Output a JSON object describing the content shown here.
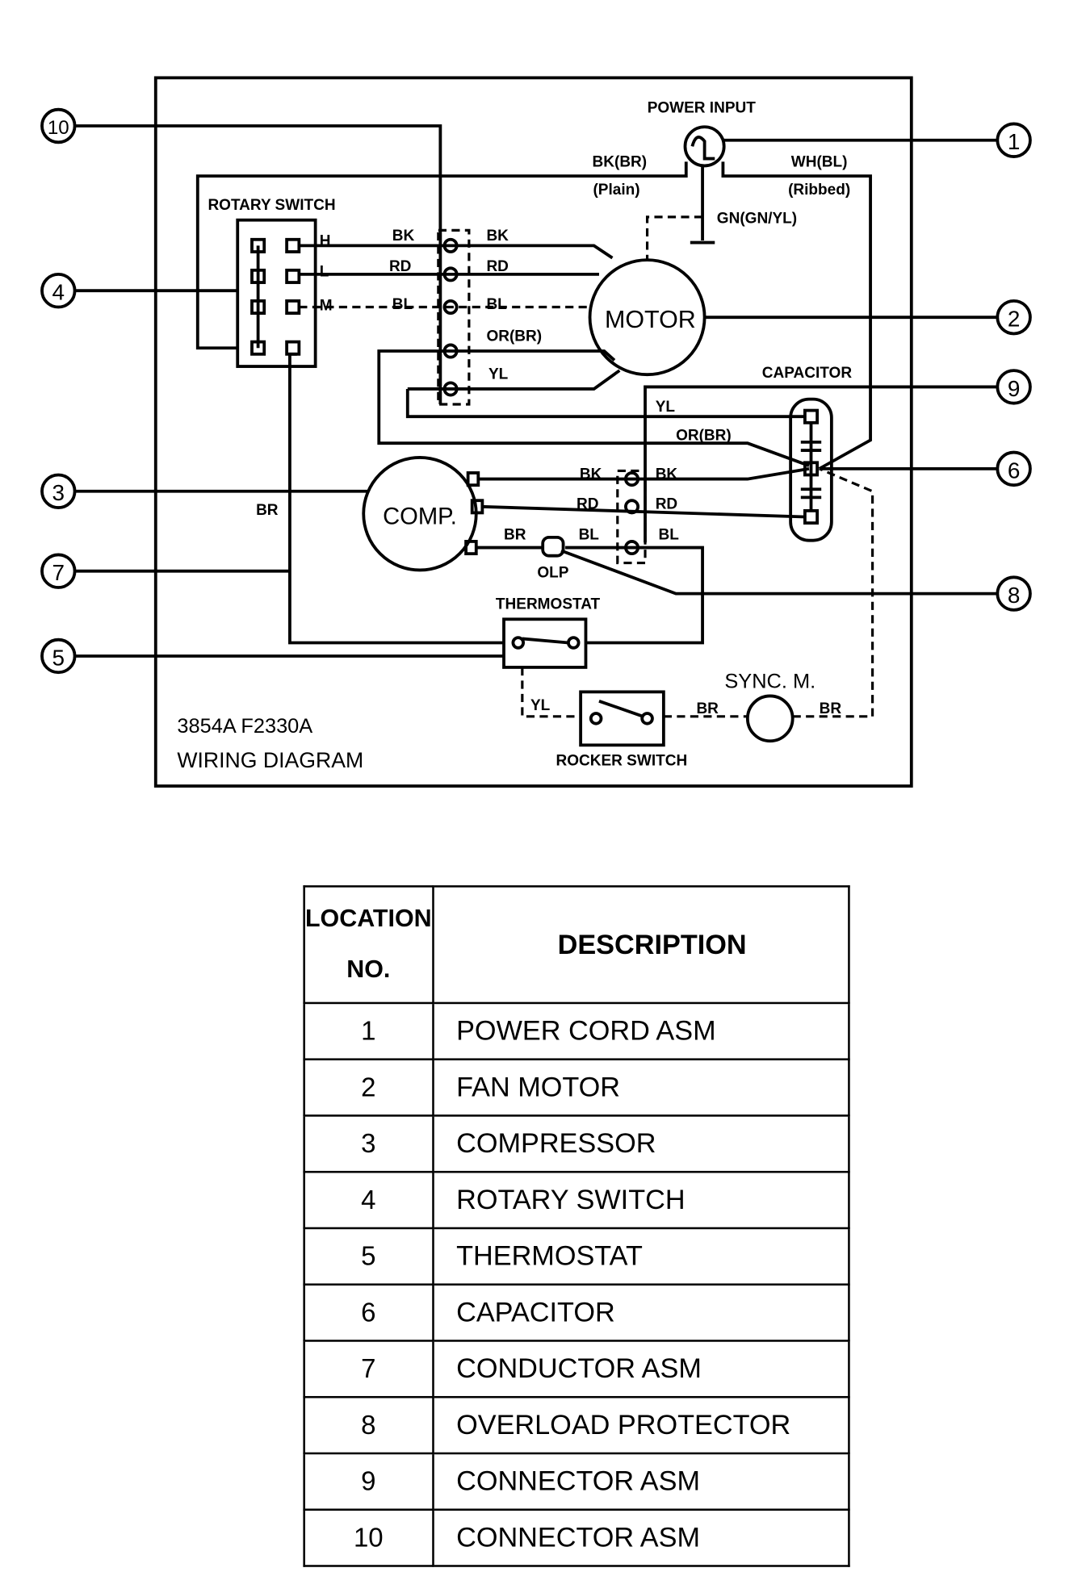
{
  "diagram": {
    "power_input": "POWER INPUT",
    "bk_br": "BK(BR)",
    "plain": "(Plain)",
    "wh_bl": "WH(BL)",
    "ribbed": "(Ribbed)",
    "gn": "GN(GN/YL)",
    "rotary_switch": "ROTARY SWITCH",
    "h": "H",
    "l": "L",
    "m": "M",
    "bk": "BK",
    "rd": "RD",
    "bl": "BL",
    "or_br": "OR(BR)",
    "yl": "YL",
    "br": "BR",
    "motor": "MOTOR",
    "capacitor": "CAPACITOR",
    "comp": "COMP.",
    "olp": "OLP",
    "thermostat": "THERMOSTAT",
    "sync_m": "SYNC. M.",
    "rocker_switch": "ROCKER SWITCH",
    "part_no": "3854A F2330A",
    "title": "WIRING DIAGRAM",
    "callouts": [
      "1",
      "2",
      "3",
      "4",
      "5",
      "6",
      "7",
      "8",
      "9",
      "10"
    ]
  },
  "table": {
    "header_location": "LOCATION",
    "header_no": "NO.",
    "header_description": "DESCRIPTION",
    "rows": [
      {
        "no": "1",
        "desc": "POWER CORD ASM"
      },
      {
        "no": "2",
        "desc": "FAN MOTOR"
      },
      {
        "no": "3",
        "desc": "COMPRESSOR"
      },
      {
        "no": "4",
        "desc": "ROTARY SWITCH"
      },
      {
        "no": "5",
        "desc": "THERMOSTAT"
      },
      {
        "no": "6",
        "desc": "CAPACITOR"
      },
      {
        "no": "7",
        "desc": "CONDUCTOR ASM"
      },
      {
        "no": "8",
        "desc": "OVERLOAD PROTECTOR"
      },
      {
        "no": "9",
        "desc": "CONNECTOR ASM"
      },
      {
        "no": "10",
        "desc": "CONNECTOR ASM"
      }
    ]
  }
}
